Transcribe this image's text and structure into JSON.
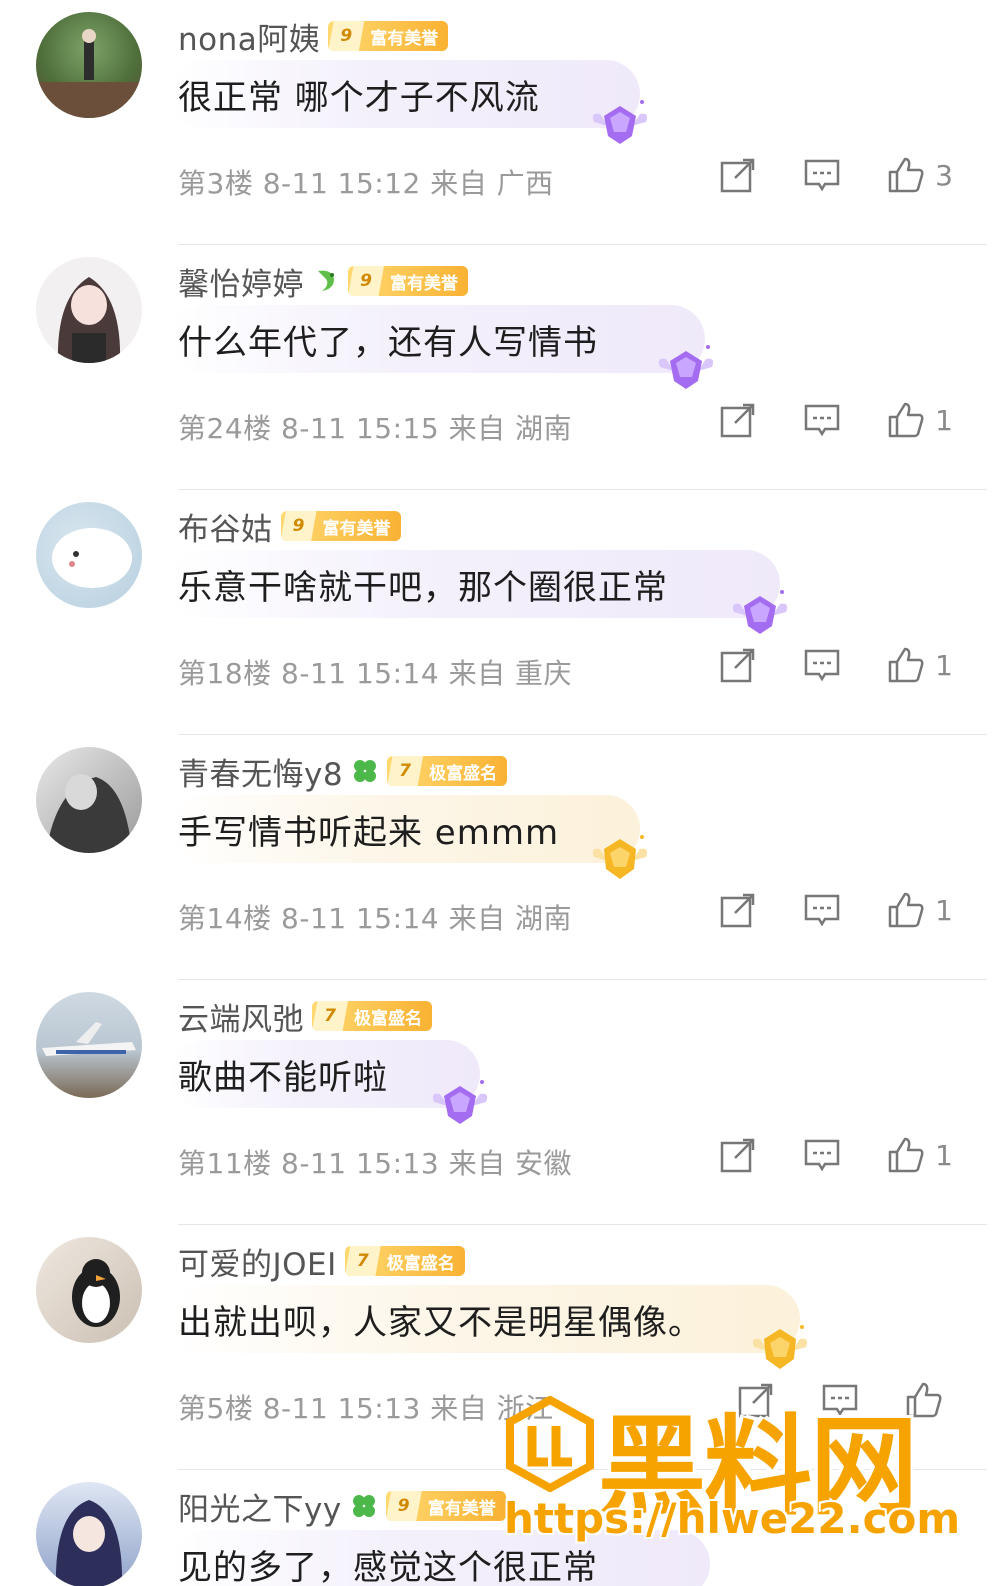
{
  "comments": [
    {
      "name": "nona阿姨",
      "badge_level": "9",
      "badge_text": "富有美誉",
      "emblem": "",
      "text": "很正常 哪个才子不风流",
      "gem": "purple-gem-icon",
      "meta": "第3楼 8-11 15:12 来自 广西",
      "likes": "3"
    },
    {
      "name": "馨怡婷婷",
      "badge_level": "9",
      "badge_text": "富有美誉",
      "emblem": "dragon-icon",
      "text": "什么年代了，还有人写情书",
      "gem": "purple-gem-icon",
      "meta": "第24楼 8-11 15:15 来自 湖南",
      "likes": "1"
    },
    {
      "name": "布谷姑",
      "badge_level": "9",
      "badge_text": "富有美誉",
      "emblem": "",
      "text": "乐意干啥就干吧，那个圈很正常",
      "gem": "purple-gem-icon",
      "meta": "第18楼 8-11 15:14 来自 重庆",
      "likes": "1"
    },
    {
      "name": "青春无悔y8",
      "badge_level": "7",
      "badge_text": "极富盛名",
      "emblem": "clover-icon",
      "text": "手写情书听起来 emmm",
      "gem": "gold-gem-icon",
      "meta": "第14楼 8-11 15:14 来自 湖南",
      "likes": "1"
    },
    {
      "name": "云端风弛",
      "badge_level": "7",
      "badge_text": "极富盛名",
      "emblem": "",
      "text": "歌曲不能听啦",
      "gem": "purple-gem-icon",
      "meta": "第11楼 8-11 15:13 来自 安徽",
      "likes": "1"
    },
    {
      "name": "可爱的JOEI",
      "badge_level": "7",
      "badge_text": "极富盛名",
      "emblem": "",
      "text": "出就出呗，人家又不是明星偶像。",
      "gem": "gold-gem-icon",
      "meta": "第5楼 8-11 15:13 来自 浙江",
      "likes": ""
    },
    {
      "name": "阳光之下yy",
      "badge_level": "9",
      "badge_text": "富有美誉",
      "emblem": "clover-icon",
      "text": "见的多了，感觉这个很正常",
      "gem": "purple-gem-icon",
      "meta": "",
      "likes": ""
    }
  ],
  "watermark": {
    "title": "黑料网",
    "url": "https://hlwe22.com"
  },
  "colors": {
    "badge_gold": "#f9b233",
    "purple_gem": "#a46cf0",
    "gold_gem": "#f5b724",
    "watermark": "#f6a300",
    "meta_gray": "#9a9a9a"
  }
}
